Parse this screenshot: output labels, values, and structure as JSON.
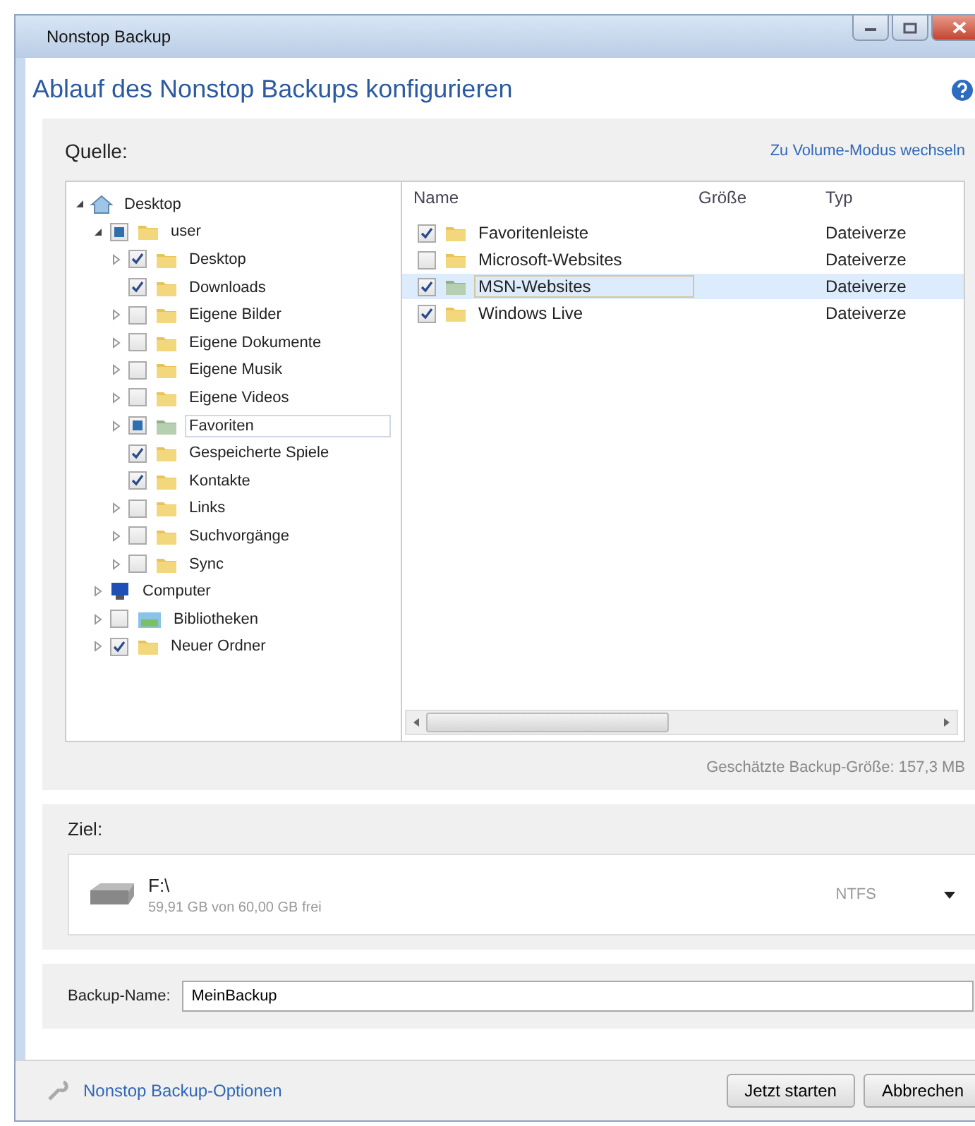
{
  "window": {
    "title": "Nonstop Backup"
  },
  "heading": "Ablauf des Nonstop Backups konfigurieren",
  "source": {
    "label": "Quelle:",
    "mode_link": "Zu Volume-Modus wechseln",
    "tree": [
      {
        "label": "Desktop",
        "kind": "home",
        "expandable": true,
        "expanded": true,
        "selected": false,
        "children": [
          {
            "label": "user",
            "kind": "folder",
            "expandable": true,
            "expanded": true,
            "checked": false,
            "partial": true,
            "selected": false,
            "children": [
              {
                "label": "Desktop",
                "kind": "folder",
                "expandable": true,
                "expanded": false,
                "checked": true,
                "partial": false,
                "selected": false
              },
              {
                "label": "Downloads",
                "kind": "folder",
                "expandable": false,
                "expanded": false,
                "checked": true,
                "partial": false,
                "selected": false
              },
              {
                "label": "Eigene Bilder",
                "kind": "folder",
                "expandable": true,
                "expanded": false,
                "checked": false,
                "partial": false,
                "selected": false
              },
              {
                "label": "Eigene Dokumente",
                "kind": "folder",
                "expandable": true,
                "expanded": false,
                "checked": false,
                "partial": false,
                "selected": false
              },
              {
                "label": "Eigene Musik",
                "kind": "folder",
                "expandable": true,
                "expanded": false,
                "checked": false,
                "partial": false,
                "selected": false
              },
              {
                "label": "Eigene Videos",
                "kind": "folder",
                "expandable": true,
                "expanded": false,
                "checked": false,
                "partial": false,
                "selected": false
              },
              {
                "label": "Favoriten",
                "kind": "favorites",
                "expandable": true,
                "expanded": false,
                "checked": false,
                "partial": true,
                "selected": true
              },
              {
                "label": "Gespeicherte Spiele",
                "kind": "folder",
                "expandable": false,
                "expanded": false,
                "checked": true,
                "partial": false,
                "selected": false
              },
              {
                "label": "Kontakte",
                "kind": "folder",
                "expandable": false,
                "expanded": false,
                "checked": true,
                "partial": false,
                "selected": false
              },
              {
                "label": "Links",
                "kind": "folder",
                "expandable": true,
                "expanded": false,
                "checked": false,
                "partial": false,
                "selected": false
              },
              {
                "label": "Suchvorgänge",
                "kind": "folder",
                "expandable": true,
                "expanded": false,
                "checked": false,
                "partial": false,
                "selected": false
              },
              {
                "label": "Sync",
                "kind": "folder",
                "expandable": true,
                "expanded": false,
                "checked": false,
                "partial": false,
                "selected": false
              }
            ]
          },
          {
            "label": "Computer",
            "kind": "computer",
            "expandable": true,
            "expanded": false,
            "selected": false
          },
          {
            "label": "Bibliotheken",
            "kind": "library",
            "expandable": true,
            "expanded": false,
            "checked": false,
            "partial": false,
            "selected": false
          },
          {
            "label": "Neuer Ordner",
            "kind": "folder",
            "expandable": true,
            "expanded": false,
            "checked": true,
            "partial": false,
            "selected": false
          }
        ]
      }
    ],
    "columns": [
      "Name",
      "Größe",
      "Typ"
    ],
    "files": [
      {
        "name": "Favoritenleiste",
        "kind": "folder",
        "type": "Dateiverze",
        "checked": true,
        "selected": false
      },
      {
        "name": "Microsoft-Websites",
        "kind": "folder",
        "type": "Dateiverze",
        "checked": false,
        "selected": false
      },
      {
        "name": "MSN-Websites",
        "kind": "favorites",
        "type": "Dateiverze",
        "checked": true,
        "selected": true
      },
      {
        "name": "Windows Live",
        "kind": "folder",
        "type": "Dateiverze",
        "checked": true,
        "selected": false
      }
    ],
    "estimate": "Geschätzte Backup-Größe: 157,3 MB"
  },
  "target": {
    "label": "Ziel:",
    "drive": "F:\\",
    "free": "59,91 GB von 60,00 GB frei",
    "fs": "NTFS"
  },
  "backup_name": {
    "label": "Backup-Name:",
    "value": "MeinBackup"
  },
  "options_link": "Nonstop Backup-Optionen",
  "buttons": [
    "Jetzt starten",
    "Abbrechen"
  ]
}
